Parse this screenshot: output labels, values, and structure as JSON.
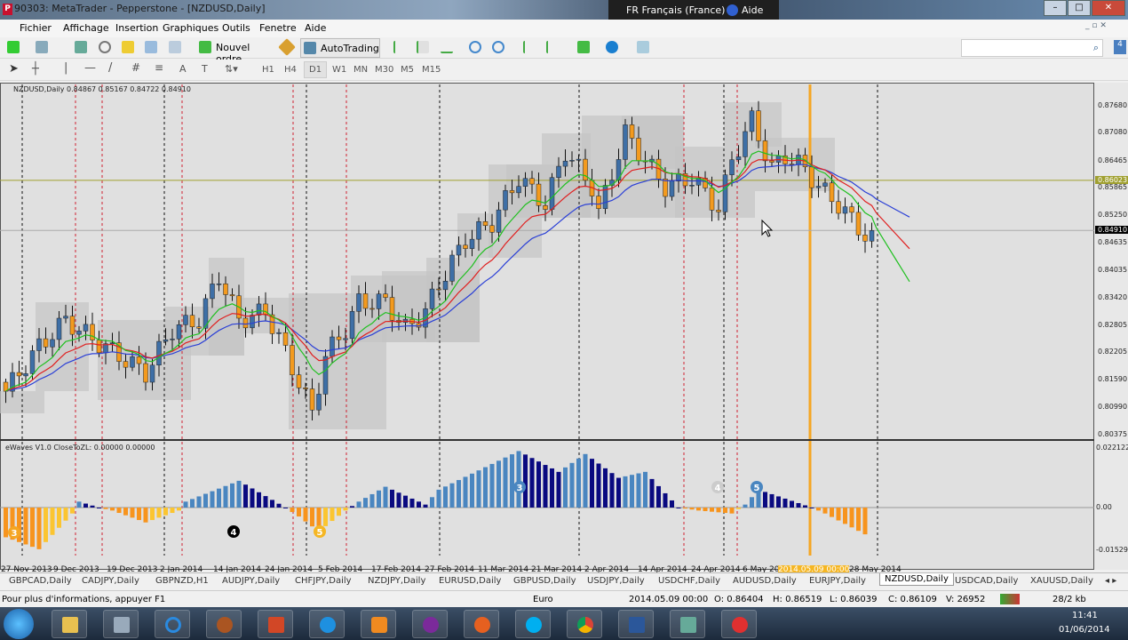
{
  "window": {
    "title": "90303: MetaTrader - Pepperstone - [NZDUSD,Daily]",
    "lang": "FR Français (France)",
    "help": "Aide"
  },
  "menu": [
    "Fichier",
    "Affichage",
    "Insertion",
    "Graphiques",
    "Outils",
    "Fenetre",
    "Aide"
  ],
  "toolbar": {
    "new_order": "Nouvel ordre",
    "autotrading": "AutoTrading"
  },
  "timeframes": [
    "H1",
    "H4",
    "D1",
    "W1",
    "MN",
    "M30",
    "M5",
    "M15"
  ],
  "active_timeframe": "D1",
  "chart": {
    "header": "NZDUSD,Daily  0.84867 0.85167 0.84722 0.84910",
    "price_ticks": [
      "0.87680",
      "0.87080",
      "0.86465",
      "0.85865",
      "0.85250",
      "0.84635",
      "0.84035",
      "0.83420",
      "0.82805",
      "0.82205",
      "0.81590",
      "0.80990",
      "0.80375"
    ],
    "price_range": [
      0.80375,
      0.8768
    ],
    "marker_line": {
      "value": "0.86023",
      "color": "#a0a030"
    },
    "bid_line": {
      "value": "0.84910"
    },
    "close_keypoints": [
      [
        0,
        0.8134
      ],
      [
        5,
        0.8233
      ],
      [
        9,
        0.8292
      ],
      [
        13,
        0.825
      ],
      [
        17,
        0.8213
      ],
      [
        21,
        0.8174
      ],
      [
        25,
        0.8272
      ],
      [
        29,
        0.8292
      ],
      [
        32,
        0.8391
      ],
      [
        35,
        0.8292
      ],
      [
        39,
        0.8311
      ],
      [
        41,
        0.8252
      ],
      [
        44,
        0.8154
      ],
      [
        46,
        0.8085
      ],
      [
        48,
        0.8213
      ],
      [
        51,
        0.8272
      ],
      [
        53,
        0.8332
      ],
      [
        57,
        0.8332
      ],
      [
        60,
        0.8272
      ],
      [
        63,
        0.8311
      ],
      [
        65,
        0.8371
      ],
      [
        69,
        0.847
      ],
      [
        73,
        0.8509
      ],
      [
        77,
        0.8608
      ],
      [
        81,
        0.8549
      ],
      [
        84,
        0.8667
      ],
      [
        88,
        0.8588
      ],
      [
        89,
        0.8529
      ],
      [
        93,
        0.8707
      ],
      [
        96,
        0.8647
      ],
      [
        99,
        0.8588
      ],
      [
        103,
        0.8608
      ],
      [
        107,
        0.8539
      ],
      [
        109,
        0.8647
      ],
      [
        112,
        0.8736
      ],
      [
        115,
        0.8628
      ],
      [
        117,
        0.8657
      ],
      [
        120,
        0.8628
      ],
      [
        122,
        0.8588
      ],
      [
        125,
        0.8549
      ],
      [
        129,
        0.848
      ],
      [
        130,
        0.8491
      ]
    ],
    "bull_color": "#3e6fa6",
    "bear_color": "#f39a1e",
    "ma_colors": [
      "#2a3fd6",
      "#e02020",
      "#20c020"
    ],
    "indicator": {
      "label": "eWaves V1.0 CloseToZL: 0.00000 0.00000",
      "ticks": [
        "0.022122",
        "0.00",
        "-0.015295"
      ],
      "range": [
        -0.015295,
        0.022122
      ],
      "keypoints": [
        [
          0,
          -0.01
        ],
        [
          5,
          -0.014
        ],
        [
          10,
          -0.002
        ],
        [
          11,
          0.002
        ],
        [
          14,
          0.0
        ],
        [
          16,
          -0.001
        ],
        [
          21,
          -0.005
        ],
        [
          26,
          -0.001
        ],
        [
          27,
          0.002
        ],
        [
          35,
          0.009
        ],
        [
          42,
          0.0
        ],
        [
          44,
          -0.003
        ],
        [
          47,
          -0.008
        ],
        [
          51,
          -0.001
        ],
        [
          53,
          0.002
        ],
        [
          57,
          0.007
        ],
        [
          63,
          0.001
        ],
        [
          65,
          0.006
        ],
        [
          77,
          0.019
        ],
        [
          83,
          0.012
        ],
        [
          87,
          0.018
        ],
        [
          92,
          0.01
        ],
        [
          96,
          0.012
        ],
        [
          101,
          0.0
        ],
        [
          104,
          -0.001
        ],
        [
          109,
          -0.002
        ],
        [
          111,
          0.001
        ],
        [
          113,
          0.006
        ],
        [
          121,
          0.0
        ],
        [
          123,
          -0.002
        ],
        [
          129,
          -0.009
        ]
      ],
      "wave_labels": [
        "3",
        "4",
        "5",
        "3",
        "4",
        "5"
      ],
      "rise_pos": "#4a86c0",
      "fall_pos": "#0a0a80",
      "rise_neg": "#fbc531",
      "fall_neg": "#f7941d"
    },
    "dates": [
      "27 Nov 2013",
      "9 Dec 2013",
      "19 Dec 2013",
      "2 Jan 2014",
      "14 Jan 2014",
      "24 Jan 2014",
      "5 Feb 2014",
      "17 Feb 2014",
      "27 Feb 2014",
      "11 Mar 2014",
      "21 Mar 2014",
      "2 Apr 2014",
      "14 Apr 2014",
      "24 Apr 2014",
      "6 May 20",
      "2014.05.09 00:00",
      "28 May 2014"
    ]
  },
  "tabs": [
    "GBPCAD,Daily",
    "CADJPY,Daily",
    "GBPNZD,H1",
    "AUDJPY,Daily",
    "CHFJPY,Daily",
    "NZDJPY,Daily",
    "EURUSD,Daily",
    "GBPUSD,Daily",
    "USDJPY,Daily",
    "USDCHF,Daily",
    "AUDUSD,Daily",
    "EURJPY,Daily",
    "NZDUSD,Daily",
    "USDCAD,Daily",
    "XAUUSD,Daily"
  ],
  "active_tab": "NZDUSD,Daily",
  "status": {
    "hint": "Pour plus d'informations, appuyer F1",
    "profile": "Euro",
    "time": "2014.05.09 00:00",
    "open": "O: 0.86404",
    "high": "H: 0.86519",
    "low": "L: 0.86039",
    "close": "C: 0.86109",
    "volume": "V: 26952",
    "traffic": "28/2 kb"
  },
  "clock": {
    "time": "11:41",
    "date": "01/06/2014"
  }
}
